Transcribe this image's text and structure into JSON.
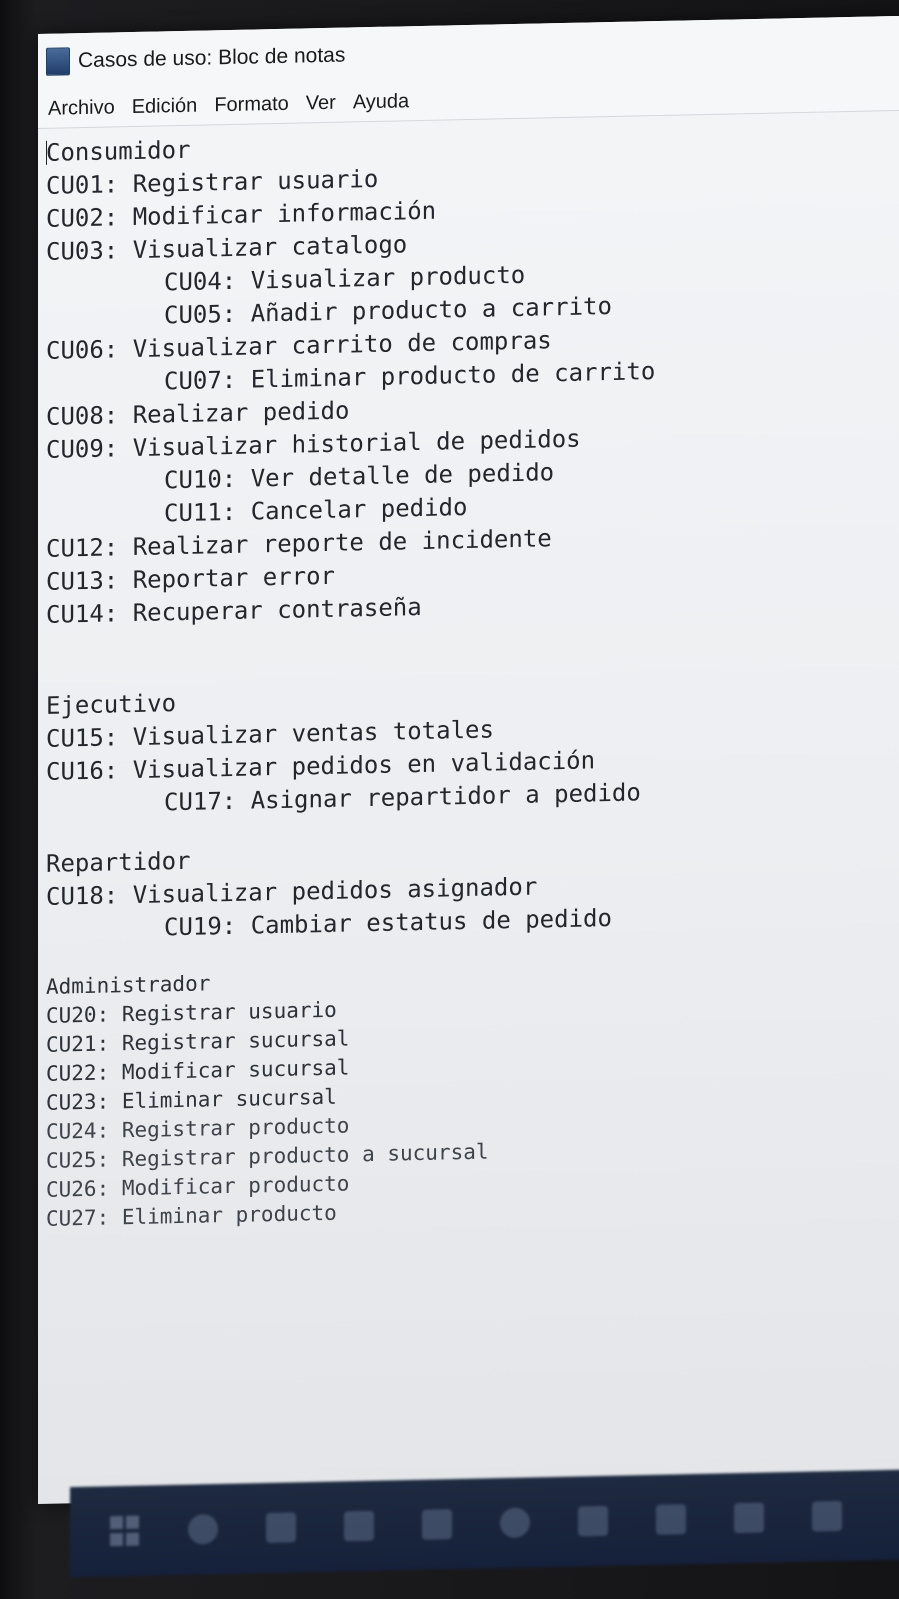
{
  "window": {
    "title": "Casos de uso: Bloc de notas"
  },
  "menu": {
    "items": [
      "Archivo",
      "Edición",
      "Formato",
      "Ver",
      "Ayuda"
    ]
  },
  "editor": {
    "lines": [
      "Consumidor",
      "CU01: Registrar usuario",
      "CU02: Modificar información",
      "CU03: Visualizar catalogo",
      "CU04: Visualizar producto",
      "CU05: Añadir producto a carrito",
      "CU06: Visualizar carrito de compras",
      "CU07: Eliminar producto de carrito",
      "CU08: Realizar pedido",
      "CU09: Visualizar historial de pedidos",
      "CU10: Ver detalle de pedido",
      "CU11: Cancelar pedido",
      "CU12: Realizar reporte de incidente",
      "CU13: Reportar error",
      "CU14: Recuperar contraseña",
      "Ejecutivo",
      "CU15: Visualizar ventas totales",
      "CU16: Visualizar pedidos en validación",
      "CU17: Asignar repartidor a pedido",
      "Repartidor",
      "CU18: Visualizar pedidos asignador",
      "CU19: Cambiar estatus de pedido",
      "Administrador",
      "CU20: Registrar usuario",
      "CU21: Registrar sucursal",
      "CU22: Modificar sucursal",
      "CU23: Eliminar sucursal",
      "CU24: Registrar producto",
      "CU25: Registrar producto a sucursal",
      "CU26: Modificar producto",
      "CU27: Eliminar producto"
    ]
  },
  "taskbar": {
    "icons": [
      "start-icon",
      "search-icon",
      "task-view-icon",
      "folder-icon",
      "app-icon",
      "browser-icon",
      "mail-icon",
      "office-icon",
      "explorer-icon",
      "store-icon"
    ]
  }
}
